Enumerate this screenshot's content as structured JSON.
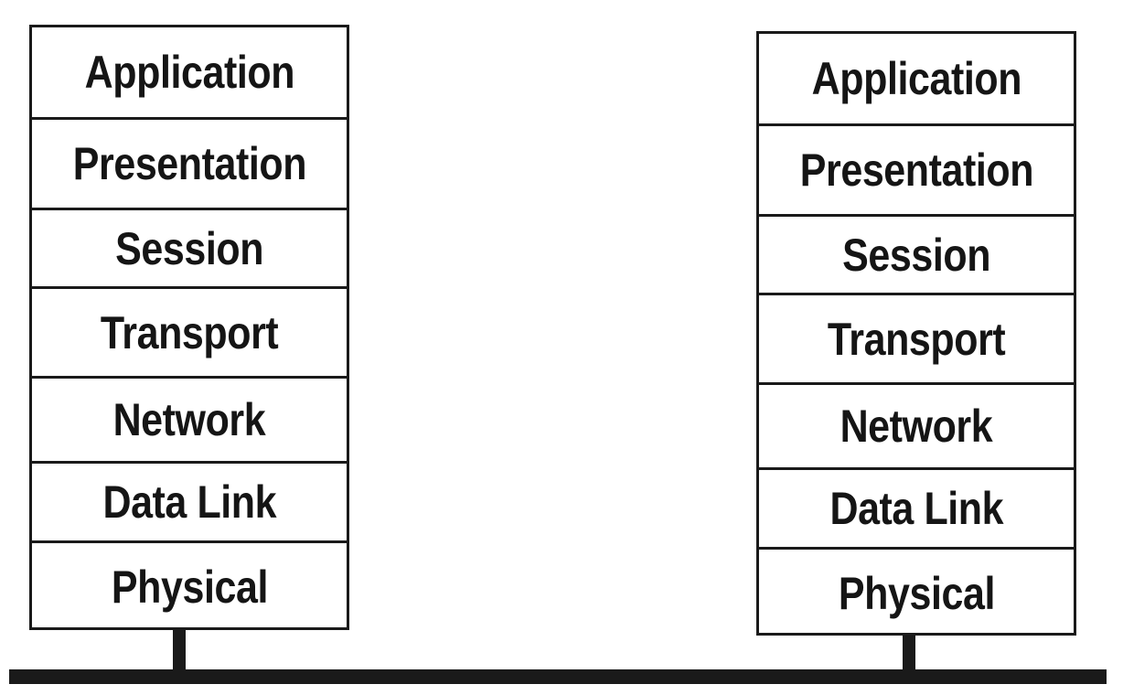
{
  "stacks": [
    {
      "layers": [
        "Application",
        "Presentation",
        "Session",
        "Transport",
        "Network",
        "Data Link",
        "Physical"
      ]
    },
    {
      "layers": [
        "Application",
        "Presentation",
        "Session",
        "Transport",
        "Network",
        "Data Link",
        "Physical"
      ]
    }
  ]
}
